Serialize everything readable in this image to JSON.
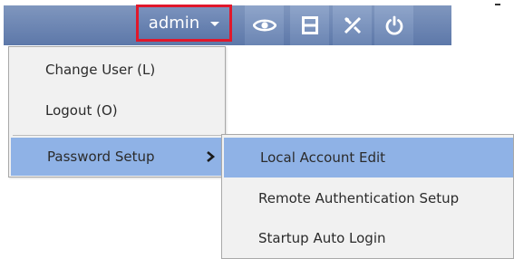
{
  "toolbar": {
    "user_label": "admin",
    "buttons": [
      {
        "icon": "eye-icon"
      },
      {
        "icon": "film-icon"
      },
      {
        "icon": "tools-icon"
      },
      {
        "icon": "power-icon"
      }
    ]
  },
  "menu": {
    "items": [
      {
        "label": "Change User (L)"
      },
      {
        "label": "Logout (O)"
      },
      {
        "label": "Password Setup"
      }
    ]
  },
  "submenu": {
    "items": [
      {
        "label": "Local Account Edit"
      },
      {
        "label": "Remote Authentication Setup"
      },
      {
        "label": "Startup Auto Login"
      }
    ]
  },
  "colors": {
    "toolbar": "#6a83b2",
    "highlight": "#8fb2e6",
    "focus_outline": "#e0182b",
    "menu_bg": "#f1f1f1"
  }
}
